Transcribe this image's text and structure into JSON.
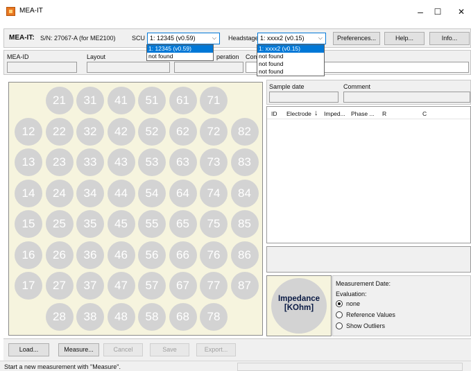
{
  "window": {
    "title": "MEA-IT",
    "min_glyph": "–",
    "max_glyph": "☐",
    "close_glyph": "✕"
  },
  "toolbar": {
    "app_label": "MEA-IT:",
    "serial": "S/N: 27067-A (for ME2100)",
    "scu_label": "SCU",
    "scu_value": "1: 12345 (v0.59)",
    "scu_options": [
      "1: 12345 (v0.59)",
      "not found"
    ],
    "headstage_label": "Headstage",
    "headstage_value": "1: xxxx2  (v0.15)",
    "headstage_options": [
      "1: xxxx2  (v0.15)",
      "not found",
      "not found",
      "not found"
    ],
    "preferences_label": "Preferences...",
    "help_label": "Help...",
    "info_label": "Info..."
  },
  "fields": {
    "mea_id_label": "MEA-ID",
    "layout_label": "Layout",
    "operation_label": "peration",
    "comment_label": "Com"
  },
  "electrodes": [
    [
      "",
      "21",
      "31",
      "41",
      "51",
      "61",
      "71",
      ""
    ],
    [
      "12",
      "22",
      "32",
      "42",
      "52",
      "62",
      "72",
      "82"
    ],
    [
      "13",
      "23",
      "33",
      "43",
      "53",
      "63",
      "73",
      "83"
    ],
    [
      "14",
      "24",
      "34",
      "44",
      "54",
      "64",
      "74",
      "84"
    ],
    [
      "15",
      "25",
      "35",
      "45",
      "55",
      "65",
      "75",
      "85"
    ],
    [
      "16",
      "26",
      "36",
      "46",
      "56",
      "66",
      "76",
      "86"
    ],
    [
      "17",
      "27",
      "37",
      "47",
      "57",
      "67",
      "77",
      "87"
    ],
    [
      "",
      "28",
      "38",
      "48",
      "58",
      "68",
      "78",
      ""
    ]
  ],
  "sample": {
    "date_label": "Sample date",
    "comment_label": "Comment"
  },
  "table": {
    "columns": [
      "ID",
      "Electrode",
      "↓",
      "Imped...",
      "Phase ...",
      "R",
      "C"
    ]
  },
  "impedance": {
    "line1": "Impedance",
    "line2": "[KOhm]"
  },
  "evaluation": {
    "date_label": "Measurement Date:",
    "eval_label": "Evaluation:",
    "options": [
      "none",
      "Reference Values",
      "Show Outliers"
    ],
    "selected": 0
  },
  "actions": {
    "load": "Load...",
    "measure": "Measure...",
    "cancel": "Cancel",
    "save": "Save",
    "export": "Export..."
  },
  "status": {
    "message": "Start a new measurement with \"Measure\"."
  }
}
